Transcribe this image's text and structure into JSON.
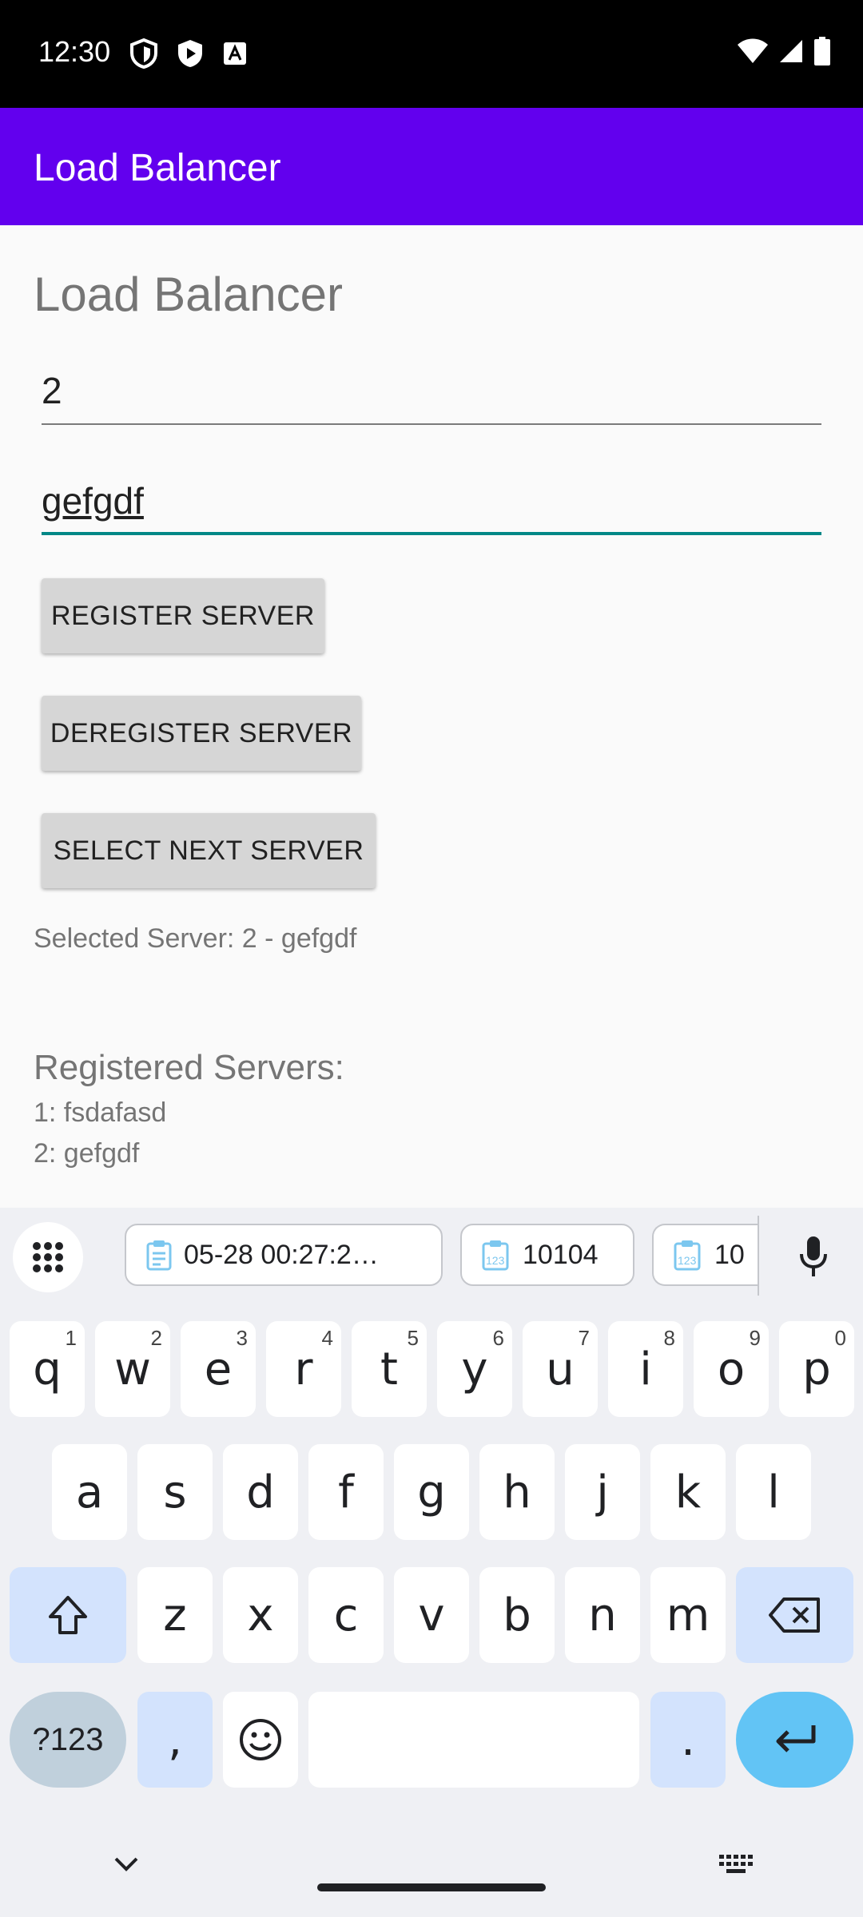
{
  "status_bar": {
    "time": "12:30"
  },
  "app_bar": {
    "title": "Load Balancer"
  },
  "main": {
    "heading": "Load Balancer",
    "id_input": {
      "value": "2"
    },
    "name_input": {
      "value": "gefgdf"
    },
    "register_label": "REGISTER SERVER",
    "deregister_label": "DEREGISTER SERVER",
    "select_next_label": "SELECT NEXT SERVER",
    "selected_server": "Selected Server: 2 - gefgdf",
    "registered_heading": "Registered Servers:",
    "registered_servers": [
      "1: fsdafasd",
      "2: gefgdf"
    ]
  },
  "keyboard": {
    "clipboard_chips": [
      "05-28 00:27:2…",
      "10104",
      "10"
    ],
    "row1": [
      {
        "key": "q",
        "hint": "1"
      },
      {
        "key": "w",
        "hint": "2"
      },
      {
        "key": "e",
        "hint": "3"
      },
      {
        "key": "r",
        "hint": "4"
      },
      {
        "key": "t",
        "hint": "5"
      },
      {
        "key": "y",
        "hint": "6"
      },
      {
        "key": "u",
        "hint": "7"
      },
      {
        "key": "i",
        "hint": "8"
      },
      {
        "key": "o",
        "hint": "9"
      },
      {
        "key": "p",
        "hint": "0"
      }
    ],
    "row2": [
      "a",
      "s",
      "d",
      "f",
      "g",
      "h",
      "j",
      "k",
      "l"
    ],
    "row3": [
      "z",
      "x",
      "c",
      "v",
      "b",
      "n",
      "m"
    ],
    "symbols_label": "?123",
    "comma_label": ",",
    "period_label": "."
  },
  "colors": {
    "primary": "#6200ee",
    "accent": "#018786",
    "enter_key": "#62c4f5"
  }
}
